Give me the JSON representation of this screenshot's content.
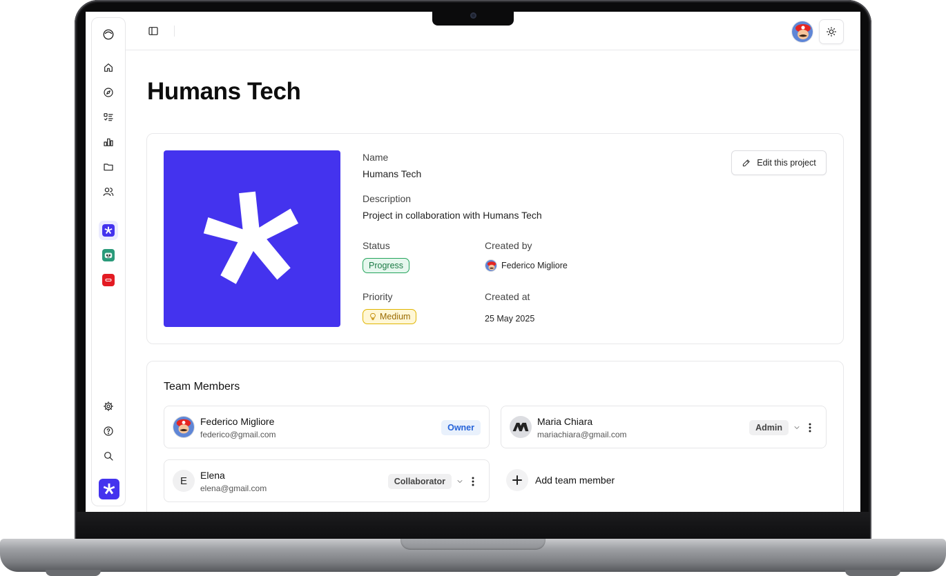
{
  "app": {
    "page_title": "Humans Tech",
    "accent_color": "#4433ee"
  },
  "sidebar": {
    "logo_icon": "circle-logo-icon",
    "nav_icons": [
      "home-icon",
      "compass-icon",
      "tasks-icon",
      "chart-icon",
      "folder-icon",
      "users-icon"
    ],
    "project_icons": [
      "asterisk-project-icon",
      "robot-project-icon",
      "red-project-icon"
    ],
    "bottom_icons": [
      "gear-icon",
      "help-icon",
      "search-icon"
    ]
  },
  "topbar": {
    "panel_toggle_icon": "sidebar-toggle-icon",
    "theme_icon": "sun-icon"
  },
  "project": {
    "name_label": "Name",
    "name_value": "Humans Tech",
    "description_label": "Description",
    "description_value": "Project in collaboration with Humans Tech",
    "status_label": "Status",
    "status_value": "Progress",
    "created_by_label": "Created by",
    "created_by_value": "Federico Migliore",
    "priority_label": "Priority",
    "priority_value": "Medium",
    "created_at_label": "Created at",
    "created_at_value": "25 May 2025",
    "edit_button": "Edit this project"
  },
  "team": {
    "title": "Team Members",
    "members": [
      {
        "name": "Federico Migliore",
        "email": "federico@gmail.com",
        "role": "Owner"
      },
      {
        "name": "Maria Chiara",
        "email": "mariachiara@gmail.com",
        "role": "Admin"
      },
      {
        "name": "Elena",
        "email": "elena@gmail.com",
        "role": "Collaborator",
        "initial": "E"
      }
    ],
    "add_label": "Add team member"
  }
}
